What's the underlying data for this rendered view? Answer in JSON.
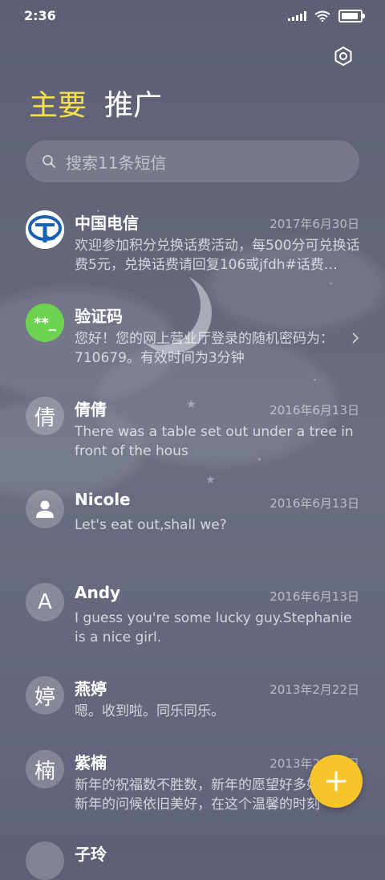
{
  "status_bar": {
    "time": "2:36"
  },
  "tabs": [
    {
      "label": "主要",
      "active": true
    },
    {
      "label": "推广",
      "active": false
    }
  ],
  "search": {
    "placeholder": "搜索11条短信"
  },
  "conversations": [
    {
      "avatar": "telecom-logo",
      "name": "中国电信",
      "date": "2017年6月30日",
      "preview": "欢迎参加积分兑换话费活动，每500分可兑换话费5元，兑换话费请回复106或jfdh#话费…"
    },
    {
      "avatar": "**_",
      "name": "验证码",
      "date": "",
      "preview": "您好！您的网上营业厅登录的随机密码为：710679。有效时间为3分钟"
    },
    {
      "avatar": "倩",
      "name": "倩倩",
      "date": "2016年6月13日",
      "preview": "There was a table set out under a tree in front of the hous"
    },
    {
      "avatar": "person-icon",
      "name": "Nicole",
      "date": "2016年6月13日",
      "preview": "Let's eat out,shall we?"
    },
    {
      "avatar": "A",
      "name": "Andy",
      "date": "2016年6月13日",
      "preview": "I guess you're some lucky guy.Stephanie is a nice girl."
    },
    {
      "avatar": "婷",
      "name": "燕婷",
      "date": "2013年2月22日",
      "preview": "嗯。收到啦。同乐同乐。"
    },
    {
      "avatar": "楠",
      "name": "紫楠",
      "date": "2013年2月22日",
      "preview": "新年的祝福数不胜数，新年的愿望好多好多，新年的问候依旧美好，在这个温馨的时刻"
    },
    {
      "avatar": "",
      "name": "子玲",
      "date": "",
      "preview": ""
    }
  ],
  "colors": {
    "accent": "#f4e04d",
    "fab": "#f7c52a",
    "verify_avatar": "#6bd34f"
  }
}
